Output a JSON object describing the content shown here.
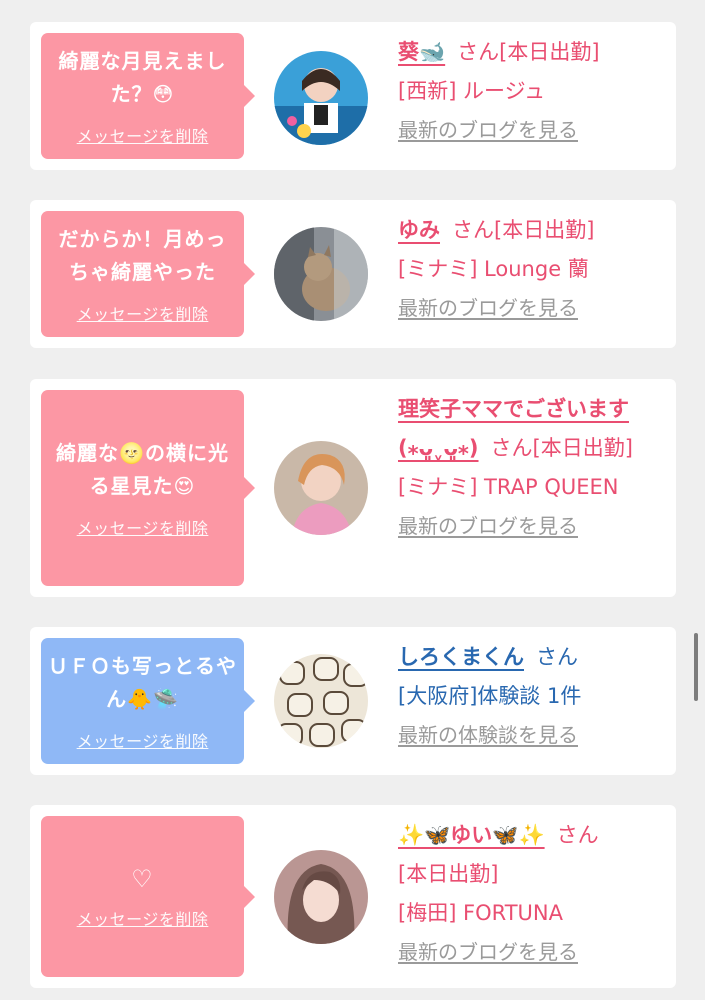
{
  "common": {
    "san": "さん",
    "delete_label": "メッセージを削除"
  },
  "cards": [
    {
      "message": "綺麗な月見えました？😳",
      "name": "葵🐋",
      "status": "[本日出勤]",
      "shop": "[西新] ルージュ",
      "link": "最新のブログを見る"
    },
    {
      "message": "だからか！月めっちゃ綺麗やった",
      "name": "ゆみ",
      "status": "[本日出勤]",
      "shop": "[ミナミ] Lounge 蘭",
      "link": "最新のブログを見る"
    },
    {
      "message": "綺麗な🌝の横に光る星見た😍",
      "name": "理笑子ママでございます(⁎ᴗ͈ˬᴗ͈⁎)",
      "status": "[本日出勤]",
      "shop": "[ミナミ] TRAP QUEEN",
      "link": "最新のブログを見る"
    },
    {
      "message": "ＵＦＯも写っとるやん🐥🛸",
      "name": "しろくまくん",
      "status": "",
      "shop": "[大阪府]体験談 1件",
      "link": "最新の体験談を見る"
    },
    {
      "message": "♡",
      "name": "✨🦋ゆい🦋✨",
      "status": "[本日出勤]",
      "shop": "[梅田] FORTUNA",
      "link": "最新のブログを見る"
    }
  ],
  "colors": {
    "pink_bubble": "#fc97a4",
    "blue_bubble": "#8fb8f6",
    "pink_text": "#e94e71",
    "blue_text": "#2968b0",
    "link_gray": "#9a9a9a"
  }
}
